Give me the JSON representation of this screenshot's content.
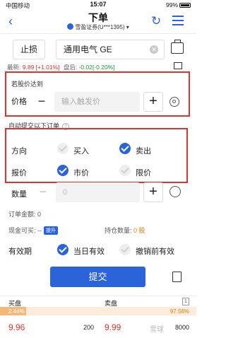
{
  "status": {
    "carrier": "中国移动",
    "time": "15:07",
    "battery": "99%"
  },
  "nav": {
    "title": "下单",
    "account": "雪盈证券(U***1395)"
  },
  "order": {
    "type": "止损",
    "stock_name": "通用电气 GE",
    "latest_label": "最新:",
    "latest_price": "9.89",
    "latest_change": "[+1.01%]",
    "premarket_label": "盘后:",
    "premarket": "-0.02[-0.20%]"
  },
  "trigger": {
    "title": "若股价达到",
    "price_label": "价格",
    "placeholder": "输入触发价"
  },
  "auto_submit": {
    "title": "自动提交以下订单",
    "help": "?"
  },
  "direction": {
    "label": "方向",
    "buy": "买入",
    "sell": "卖出",
    "buy_on": false,
    "sell_on": true
  },
  "pricing": {
    "label": "报价",
    "market": "市价",
    "limit": "限价",
    "market_on": true,
    "limit_on": false
  },
  "quantity": {
    "label": "数量",
    "value": "0"
  },
  "amount": {
    "label": "订单金额:",
    "value": "0"
  },
  "cash": {
    "label": "现金可买:",
    "value": "--",
    "tag": "提升"
  },
  "holding": {
    "label": "持仓数量:",
    "value": "0 股"
  },
  "validity": {
    "label": "有效期",
    "today": "当日有效",
    "gtc": "撤销前有效",
    "today_on": true,
    "gtc_on": false
  },
  "submit_label": "提交",
  "orderbook": {
    "bid_label": "买盘",
    "ask_label": "卖盘",
    "page": "1",
    "bid_ratio": "2.44%",
    "ask_ratio": "97.56%",
    "bid_price": "9.96",
    "bid_size": "200",
    "ask_price": "9.99",
    "ask_size": "8000",
    "watermark": "雪球"
  },
  "colors": {
    "accent": "#2b63d9",
    "up": "#e0332f",
    "down": "#1a9c3e"
  }
}
